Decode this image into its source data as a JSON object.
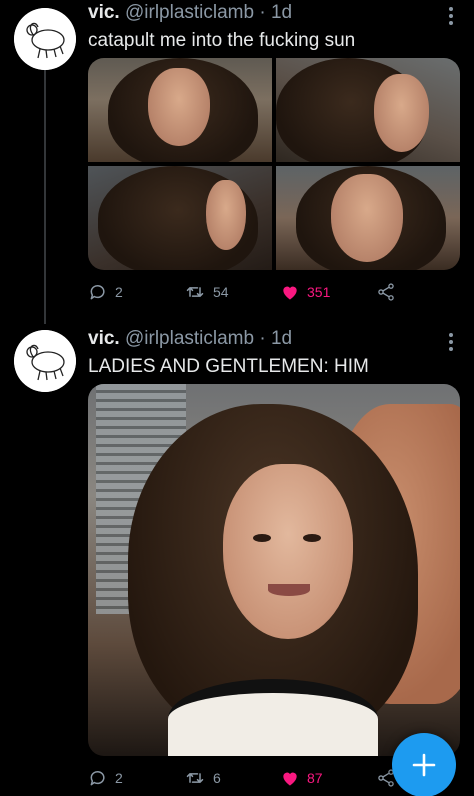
{
  "tweets": [
    {
      "name": "vic.",
      "handle": "@irlplasticlamb",
      "separator": "·",
      "time": "1d",
      "text": "catapult me into the fucking sun",
      "reply_count": "2",
      "retweet_count": "54",
      "like_count": "351",
      "liked": true
    },
    {
      "name": "vic.",
      "handle": "@irlplasticlamb",
      "separator": "·",
      "time": "1d",
      "text": "LADIES AND GENTLEMEN: HIM",
      "reply_count": "2",
      "retweet_count": "6",
      "like_count": "87",
      "liked": true
    }
  ],
  "icons": {
    "reply": "reply-icon",
    "retweet": "retweet-icon",
    "like": "heart-icon",
    "share": "share-icon",
    "more": "more-icon",
    "compose": "plus-icon"
  },
  "colors": {
    "background": "#000000",
    "text": "#e7e9ea",
    "muted": "#8b98a5",
    "like": "#f91880",
    "accent": "#1d9bf0"
  }
}
